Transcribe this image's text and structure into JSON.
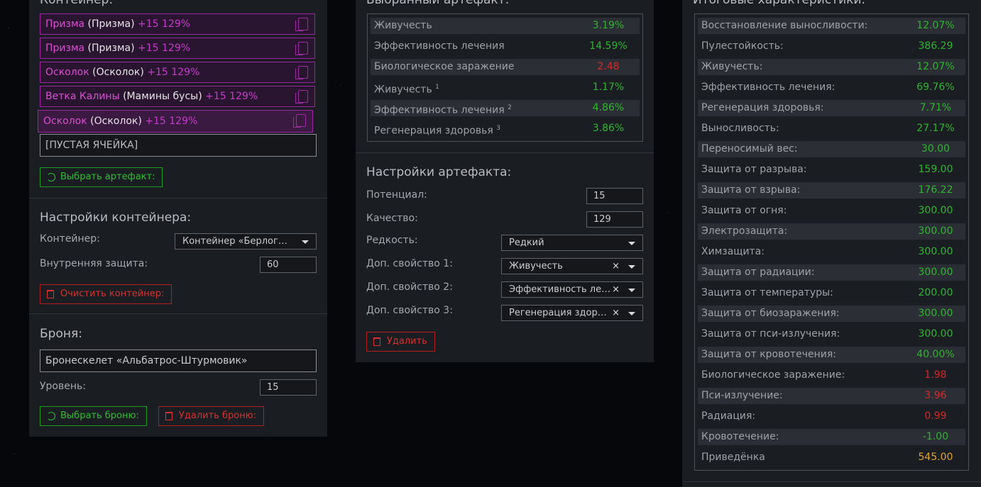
{
  "container": {
    "title": "Контейнер:",
    "slots": [
      {
        "name": "Призма",
        "sub": " (Призма)",
        "level": " +15 129%"
      },
      {
        "name": "Призма",
        "sub": " (Призма)",
        "level": " +15 129%"
      },
      {
        "name": "Осколок",
        "sub": " (Осколок)",
        "level": " +15 129%"
      },
      {
        "name": "Ветка Калины",
        "sub": " (Мамины бусы)",
        "level": " +15 129%"
      },
      {
        "name": "Осколок",
        "sub": " (Осколок)",
        "level": " +15 129%"
      }
    ],
    "empty_slot": "[ПУСТАЯ ЯЧЕЙКА]",
    "select_artifact_label": "Выбрать артефакт:",
    "settings_title": "Настройки контейнера:",
    "container_label": "Контейнер:",
    "container_value": "Контейнер «Берлога…",
    "inner_protection_label": "Внутренняя защита:",
    "inner_protection_value": "60",
    "clear_label": "Очистить контейнер:"
  },
  "armor": {
    "title": "Броня:",
    "value": "Бронескелет «Альбатрос-Штурмовик»",
    "level_label": "Уровень:",
    "level_value": "15",
    "select_label": "Выбрать броню:",
    "delete_label": "Удалить броню:"
  },
  "artifact": {
    "title": "Выбранный артефакт:",
    "stats": [
      {
        "k": "Живучесть",
        "sup": "",
        "v": "3.19%",
        "c": "green"
      },
      {
        "k": "Эффективность лечения",
        "sup": "",
        "v": "14.59%",
        "c": "green"
      },
      {
        "k": "Биологическое заражение",
        "sup": "",
        "v": "2.48",
        "c": "red"
      },
      {
        "k": "Живучесть",
        "sup": "1",
        "v": "1.17%",
        "c": "green"
      },
      {
        "k": "Эффективность лечения",
        "sup": "2",
        "v": "4.86%",
        "c": "green"
      },
      {
        "k": "Регенерация здоровья",
        "sup": "3",
        "v": "3.86%",
        "c": "green"
      }
    ],
    "settings_title": "Настройки артефакта:",
    "potential_label": "Потенциал:",
    "potential_value": "15",
    "quality_label": "Качество:",
    "quality_value": "129",
    "rarity_label": "Редкость:",
    "rarity_value": "Редкий",
    "extra1_label": "Доп. свойство 1:",
    "extra1_value": "Живучесть",
    "extra2_label": "Доп. свойство 2:",
    "extra2_value": "Эффективность ле…",
    "extra3_label": "Доп. свойство 3:",
    "extra3_value": "Регенерация здор…",
    "clear_glyph": "×",
    "delete_label": "Удалить"
  },
  "totals": {
    "title": "Итоговые характеристики:",
    "stats": [
      {
        "k": "Восстановление выносливости:",
        "v": "12.07%",
        "c": "green"
      },
      {
        "k": "Пулестойкость:",
        "v": "386.29",
        "c": "green"
      },
      {
        "k": "Живучесть:",
        "v": "12.07%",
        "c": "green"
      },
      {
        "k": "Эффективность лечения:",
        "v": "69.76%",
        "c": "green"
      },
      {
        "k": "Регенерация здоровья:",
        "v": "7.71%",
        "c": "green"
      },
      {
        "k": "Выносливость:",
        "v": "27.17%",
        "c": "green"
      },
      {
        "k": "Переносимый вес:",
        "v": "30.00",
        "c": "green"
      },
      {
        "k": "Защита от разрыва:",
        "v": "159.00",
        "c": "green"
      },
      {
        "k": "Защита от взрыва:",
        "v": "176.22",
        "c": "green"
      },
      {
        "k": "Защита от огня:",
        "v": "300.00",
        "c": "green"
      },
      {
        "k": "Электрозащита:",
        "v": "300.00",
        "c": "green"
      },
      {
        "k": "Химзащита:",
        "v": "300.00",
        "c": "green"
      },
      {
        "k": "Защита от радиации:",
        "v": "300.00",
        "c": "green"
      },
      {
        "k": "Защита от температуры:",
        "v": "200.00",
        "c": "green"
      },
      {
        "k": "Защита от биозаражения:",
        "v": "300.00",
        "c": "green"
      },
      {
        "k": "Защита от пси-излучения:",
        "v": "300.00",
        "c": "green"
      },
      {
        "k": "Защита от кровотечения:",
        "v": "40.00%",
        "c": "green"
      },
      {
        "k": "Биологическое заражение:",
        "v": "1.98",
        "c": "red"
      },
      {
        "k": "Пси-излучение:",
        "v": "3.96",
        "c": "red"
      },
      {
        "k": "Радиация:",
        "v": "0.99",
        "c": "red"
      },
      {
        "k": "Кровотечение:",
        "v": "-1.00",
        "c": "green"
      },
      {
        "k": "Приведёнка",
        "v": "545.00",
        "c": "gold"
      }
    ]
  }
}
